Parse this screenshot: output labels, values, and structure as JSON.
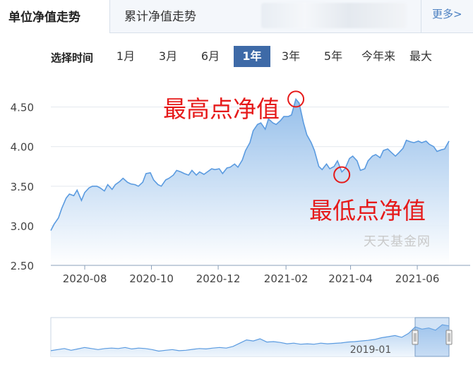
{
  "tabs": {
    "active_label": "单位净值走势",
    "second_label": "累计净值走势",
    "more_label": "更多>"
  },
  "range": {
    "label": "选择时间",
    "options": [
      "1月",
      "3月",
      "6月",
      "1年",
      "3年",
      "5年",
      "今年来",
      "最大"
    ],
    "selected": "1年"
  },
  "watermark": "天天基金网",
  "annotations": {
    "high": "最高点净值",
    "low": "最低点净值"
  },
  "colors": {
    "line": "#5b9be0",
    "fill_top": "#8fbbe9",
    "active_tab": "#3e6aa7",
    "annotation": "#e61a1a"
  },
  "chart_data": {
    "type": "area",
    "title": "",
    "xlabel": "",
    "ylabel": "",
    "ylim": [
      2.5,
      4.8
    ],
    "yticks": [
      "2.50",
      "3.00",
      "3.50",
      "4.00",
      "4.50"
    ],
    "xticks": [
      "2020-08",
      "2020-10",
      "2020-12",
      "2021-02",
      "2021-04",
      "2021-06"
    ],
    "grid": true,
    "series": [
      {
        "x": [
          "2020-07-01",
          "2020-07-04",
          "2020-07-08",
          "2020-07-11",
          "2020-07-15",
          "2020-07-18",
          "2020-07-22",
          "2020-07-25",
          "2020-07-29",
          "2020-08-01",
          "2020-08-05",
          "2020-08-08",
          "2020-08-12",
          "2020-08-15",
          "2020-08-19",
          "2020-08-22",
          "2020-08-26",
          "2020-08-29",
          "2020-09-02",
          "2020-09-05",
          "2020-09-09",
          "2020-09-12",
          "2020-09-16",
          "2020-09-19",
          "2020-09-23",
          "2020-09-26",
          "2020-09-30",
          "2020-10-03",
          "2020-10-07",
          "2020-10-10",
          "2020-10-14",
          "2020-10-17",
          "2020-10-21",
          "2020-10-24",
          "2020-10-28",
          "2020-10-31",
          "2020-11-04",
          "2020-11-07",
          "2020-11-11",
          "2020-11-14",
          "2020-11-18",
          "2020-11-21",
          "2020-11-25",
          "2020-11-28",
          "2020-12-02",
          "2020-12-05",
          "2020-12-09",
          "2020-12-12",
          "2020-12-16",
          "2020-12-19",
          "2020-12-23",
          "2020-12-26",
          "2020-12-30",
          "2021-01-02",
          "2021-01-06",
          "2021-01-09",
          "2021-01-13",
          "2021-01-16",
          "2021-01-20",
          "2021-01-23",
          "2021-01-27",
          "2021-01-30",
          "2021-02-03",
          "2021-02-06",
          "2021-02-10",
          "2021-02-13",
          "2021-02-17",
          "2021-02-20",
          "2021-02-24",
          "2021-02-27",
          "2021-03-03",
          "2021-03-06",
          "2021-03-10",
          "2021-03-13",
          "2021-03-17",
          "2021-03-20",
          "2021-03-24",
          "2021-03-27",
          "2021-03-31",
          "2021-04-03",
          "2021-04-07",
          "2021-04-10",
          "2021-04-14",
          "2021-04-17",
          "2021-04-21",
          "2021-04-24",
          "2021-04-28",
          "2021-05-01",
          "2021-05-05",
          "2021-05-08",
          "2021-05-12",
          "2021-05-15",
          "2021-05-19",
          "2021-05-22",
          "2021-05-26",
          "2021-05-29",
          "2021-06-02",
          "2021-06-05",
          "2021-06-09",
          "2021-06-12",
          "2021-06-16",
          "2021-06-19",
          "2021-06-23",
          "2021-06-26",
          "2021-06-30"
        ],
        "y": [
          2.94,
          3.02,
          3.1,
          3.22,
          3.35,
          3.4,
          3.38,
          3.45,
          3.32,
          3.42,
          3.48,
          3.5,
          3.5,
          3.48,
          3.44,
          3.52,
          3.46,
          3.52,
          3.56,
          3.6,
          3.55,
          3.53,
          3.52,
          3.5,
          3.55,
          3.66,
          3.67,
          3.58,
          3.52,
          3.5,
          3.58,
          3.6,
          3.64,
          3.7,
          3.68,
          3.66,
          3.64,
          3.7,
          3.64,
          3.68,
          3.65,
          3.68,
          3.72,
          3.71,
          3.72,
          3.66,
          3.73,
          3.74,
          3.78,
          3.74,
          3.83,
          3.95,
          4.05,
          4.2,
          4.28,
          4.3,
          4.22,
          4.35,
          4.3,
          4.28,
          4.33,
          4.38,
          4.38,
          4.4,
          4.6,
          4.55,
          4.3,
          4.15,
          4.05,
          3.95,
          3.75,
          3.71,
          3.78,
          3.72,
          3.75,
          3.82,
          3.68,
          3.72,
          3.85,
          3.88,
          3.82,
          3.7,
          3.72,
          3.82,
          3.88,
          3.9,
          3.86,
          3.95,
          3.97,
          3.93,
          3.88,
          3.92,
          3.98,
          4.08,
          4.06,
          4.05,
          4.07,
          4.05,
          4.07,
          4.03,
          4.0,
          3.94,
          3.96,
          3.97,
          4.07
        ]
      }
    ]
  },
  "navigator": {
    "label": "2019-01",
    "y": [
      2.4,
      2.45,
      2.5,
      2.42,
      2.48,
      2.55,
      2.5,
      2.45,
      2.5,
      2.52,
      2.5,
      2.55,
      2.48,
      2.52,
      2.5,
      2.45,
      2.38,
      2.42,
      2.45,
      2.4,
      2.42,
      2.46,
      2.5,
      2.48,
      2.52,
      2.55,
      2.52,
      2.6,
      2.75,
      2.9,
      2.85,
      2.95,
      2.8,
      2.82,
      2.78,
      2.72,
      2.75,
      2.7,
      2.72,
      2.7,
      2.75,
      2.72,
      2.74,
      2.76,
      2.8,
      2.82,
      2.85,
      2.88,
      2.92,
      3.0,
      3.05,
      3.1,
      3.02,
      3.2,
      3.5,
      3.4,
      3.45,
      3.35,
      3.6,
      3.55
    ]
  }
}
